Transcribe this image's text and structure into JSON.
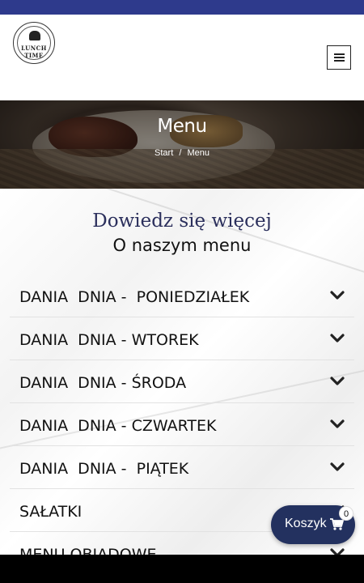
{
  "header": {
    "logo_text": "LUNCH TIME",
    "menu_icon": "hamburger-icon"
  },
  "hero": {
    "title": "Menu",
    "breadcrumb": {
      "home": "Start",
      "separator": "/",
      "current": "Menu"
    }
  },
  "section": {
    "subtitle": "Dowiedz się więcej",
    "title": "O naszym menu"
  },
  "accordion": {
    "items": [
      {
        "label": "DANIA  DNIA -  PONIEDZIAŁEK"
      },
      {
        "label": "DANIA  DNIA - WTOREK"
      },
      {
        "label": "DANIA  DNIA - ŚRODA"
      },
      {
        "label": "DANIA  DNIA - CZWARTEK"
      },
      {
        "label": "DANIA  DNIA -  PIĄTEK"
      },
      {
        "label": "SAŁATKI"
      },
      {
        "label": "MENU OBIADOWE"
      }
    ],
    "icon": "chevron-down-icon"
  },
  "cart": {
    "label": "Koszyk",
    "count": "0",
    "icon": "cart-icon"
  },
  "colors": {
    "topbar": "#2e3a8c",
    "cart_button": "#23315f",
    "subtitle": "#2b2f5c"
  }
}
